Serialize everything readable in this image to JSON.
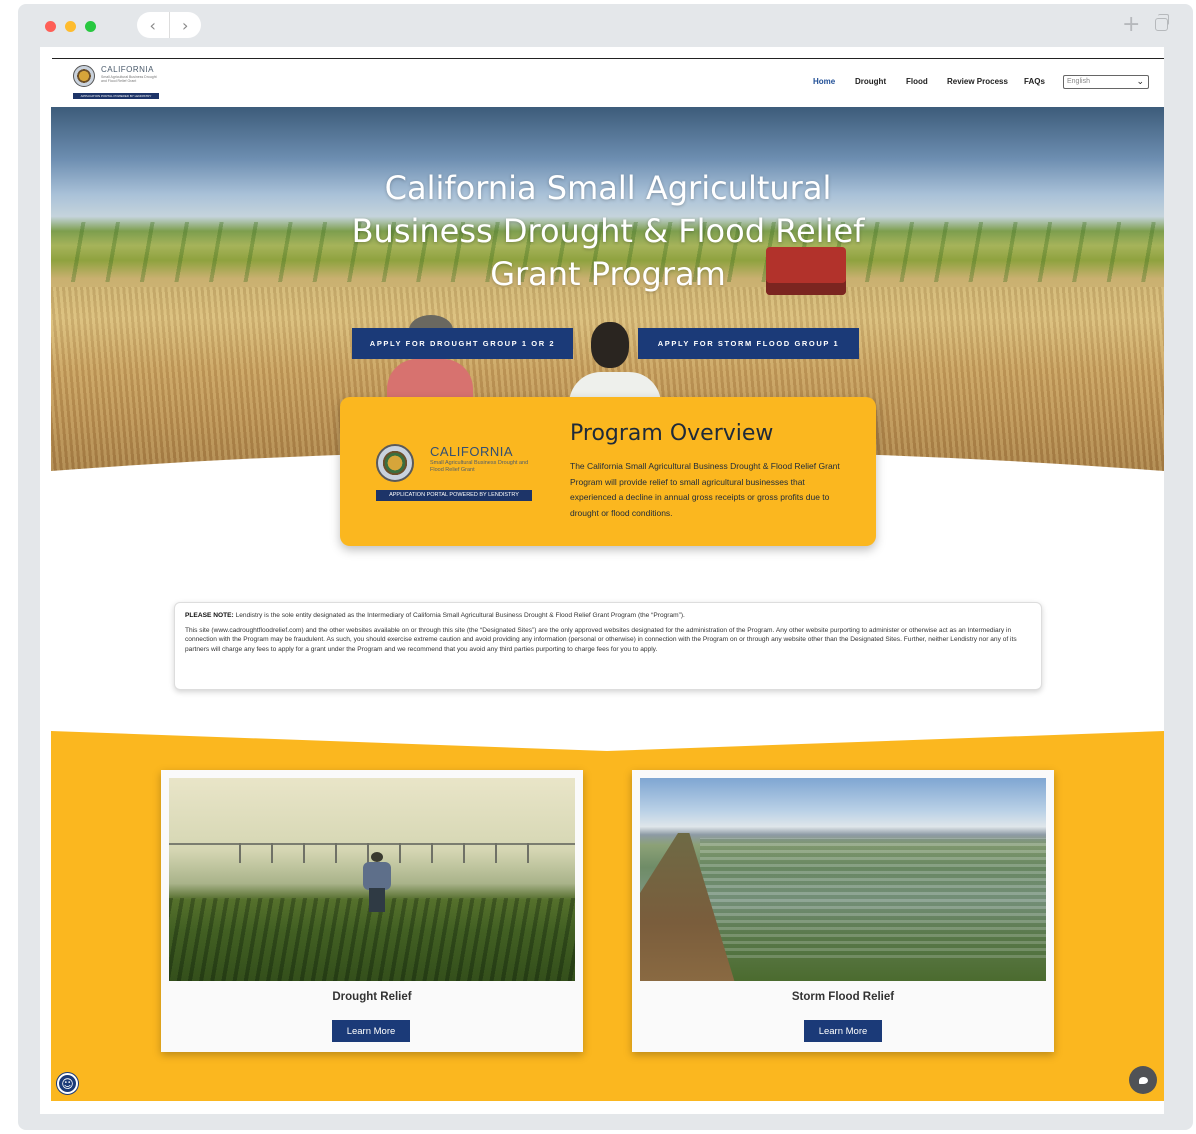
{
  "browser": {
    "back_glyph": "‹",
    "forward_glyph": "›",
    "new_tab_glyph": "+"
  },
  "header": {
    "logo": {
      "title": "CALIFORNIA",
      "subtitle": "Small Agricultural Business Drought and Flood Relief Grant",
      "bar_text": "APPLICATION PORTAL POWERED BY LENDISTRY"
    },
    "nav": [
      {
        "label": "Home",
        "active": true
      },
      {
        "label": "Drought"
      },
      {
        "label": "Flood"
      },
      {
        "label": "Review Process"
      },
      {
        "label": "FAQs"
      }
    ],
    "language": {
      "selected": "English",
      "chevron": "⌄"
    }
  },
  "hero": {
    "title": "California Small Agricultural Business Drought & Flood Relief Grant Program",
    "cta_drought": "APPLY FOR DROUGHT GROUP 1 OR 2",
    "cta_flood": "APPLY FOR STORM FLOOD GROUP 1"
  },
  "overview": {
    "logo_title": "CALIFORNIA",
    "logo_subtitle": "Small Agricultural Business Drought and Flood Relief Grant",
    "logo_bar": "APPLICATION PORTAL POWERED BY LENDISTRY",
    "title": "Program Overview",
    "text": "The California Small Agricultural Business Drought & Flood Relief Grant Program will provide relief to small agricultural businesses that experienced a decline in annual gross receipts or gross profits due to drought or flood conditions."
  },
  "notice": {
    "lead": "PLEASE NOTE:",
    "line1": " Lendistry is the sole entity designated as the Intermediary of California Small Agricultural Business Drought & Flood Relief Grant Program (the “Program”).",
    "body": "This site (www.cadroughtfloodrelief.com) and the other websites available on or through this site (the “Designated Sites”) are the only approved websites designated for the administration of the Program. Any other website purporting to administer or otherwise act as an Intermediary in connection with the Program may be fraudulent. As such, you should exercise extreme caution and avoid providing any information (personal or otherwise) in connection with the Program on or through any website other than the Designated Sites. Further, neither Lendistry nor any of its partners will charge any fees to apply for a grant under the Program and we recommend that you avoid any third parties purporting to charge fees for you to apply."
  },
  "cards": [
    {
      "title": "Drought Relief",
      "button": "Learn More"
    },
    {
      "title": "Storm Flood Relief",
      "button": "Learn More"
    }
  ],
  "colors": {
    "navy": "#1b3a78",
    "yellow": "#fbb71f",
    "nav_active": "#1f4e96"
  },
  "widgets": {
    "accessibility_icon": "accessibility-icon",
    "chat_icon": "chat-bubble-icon"
  }
}
